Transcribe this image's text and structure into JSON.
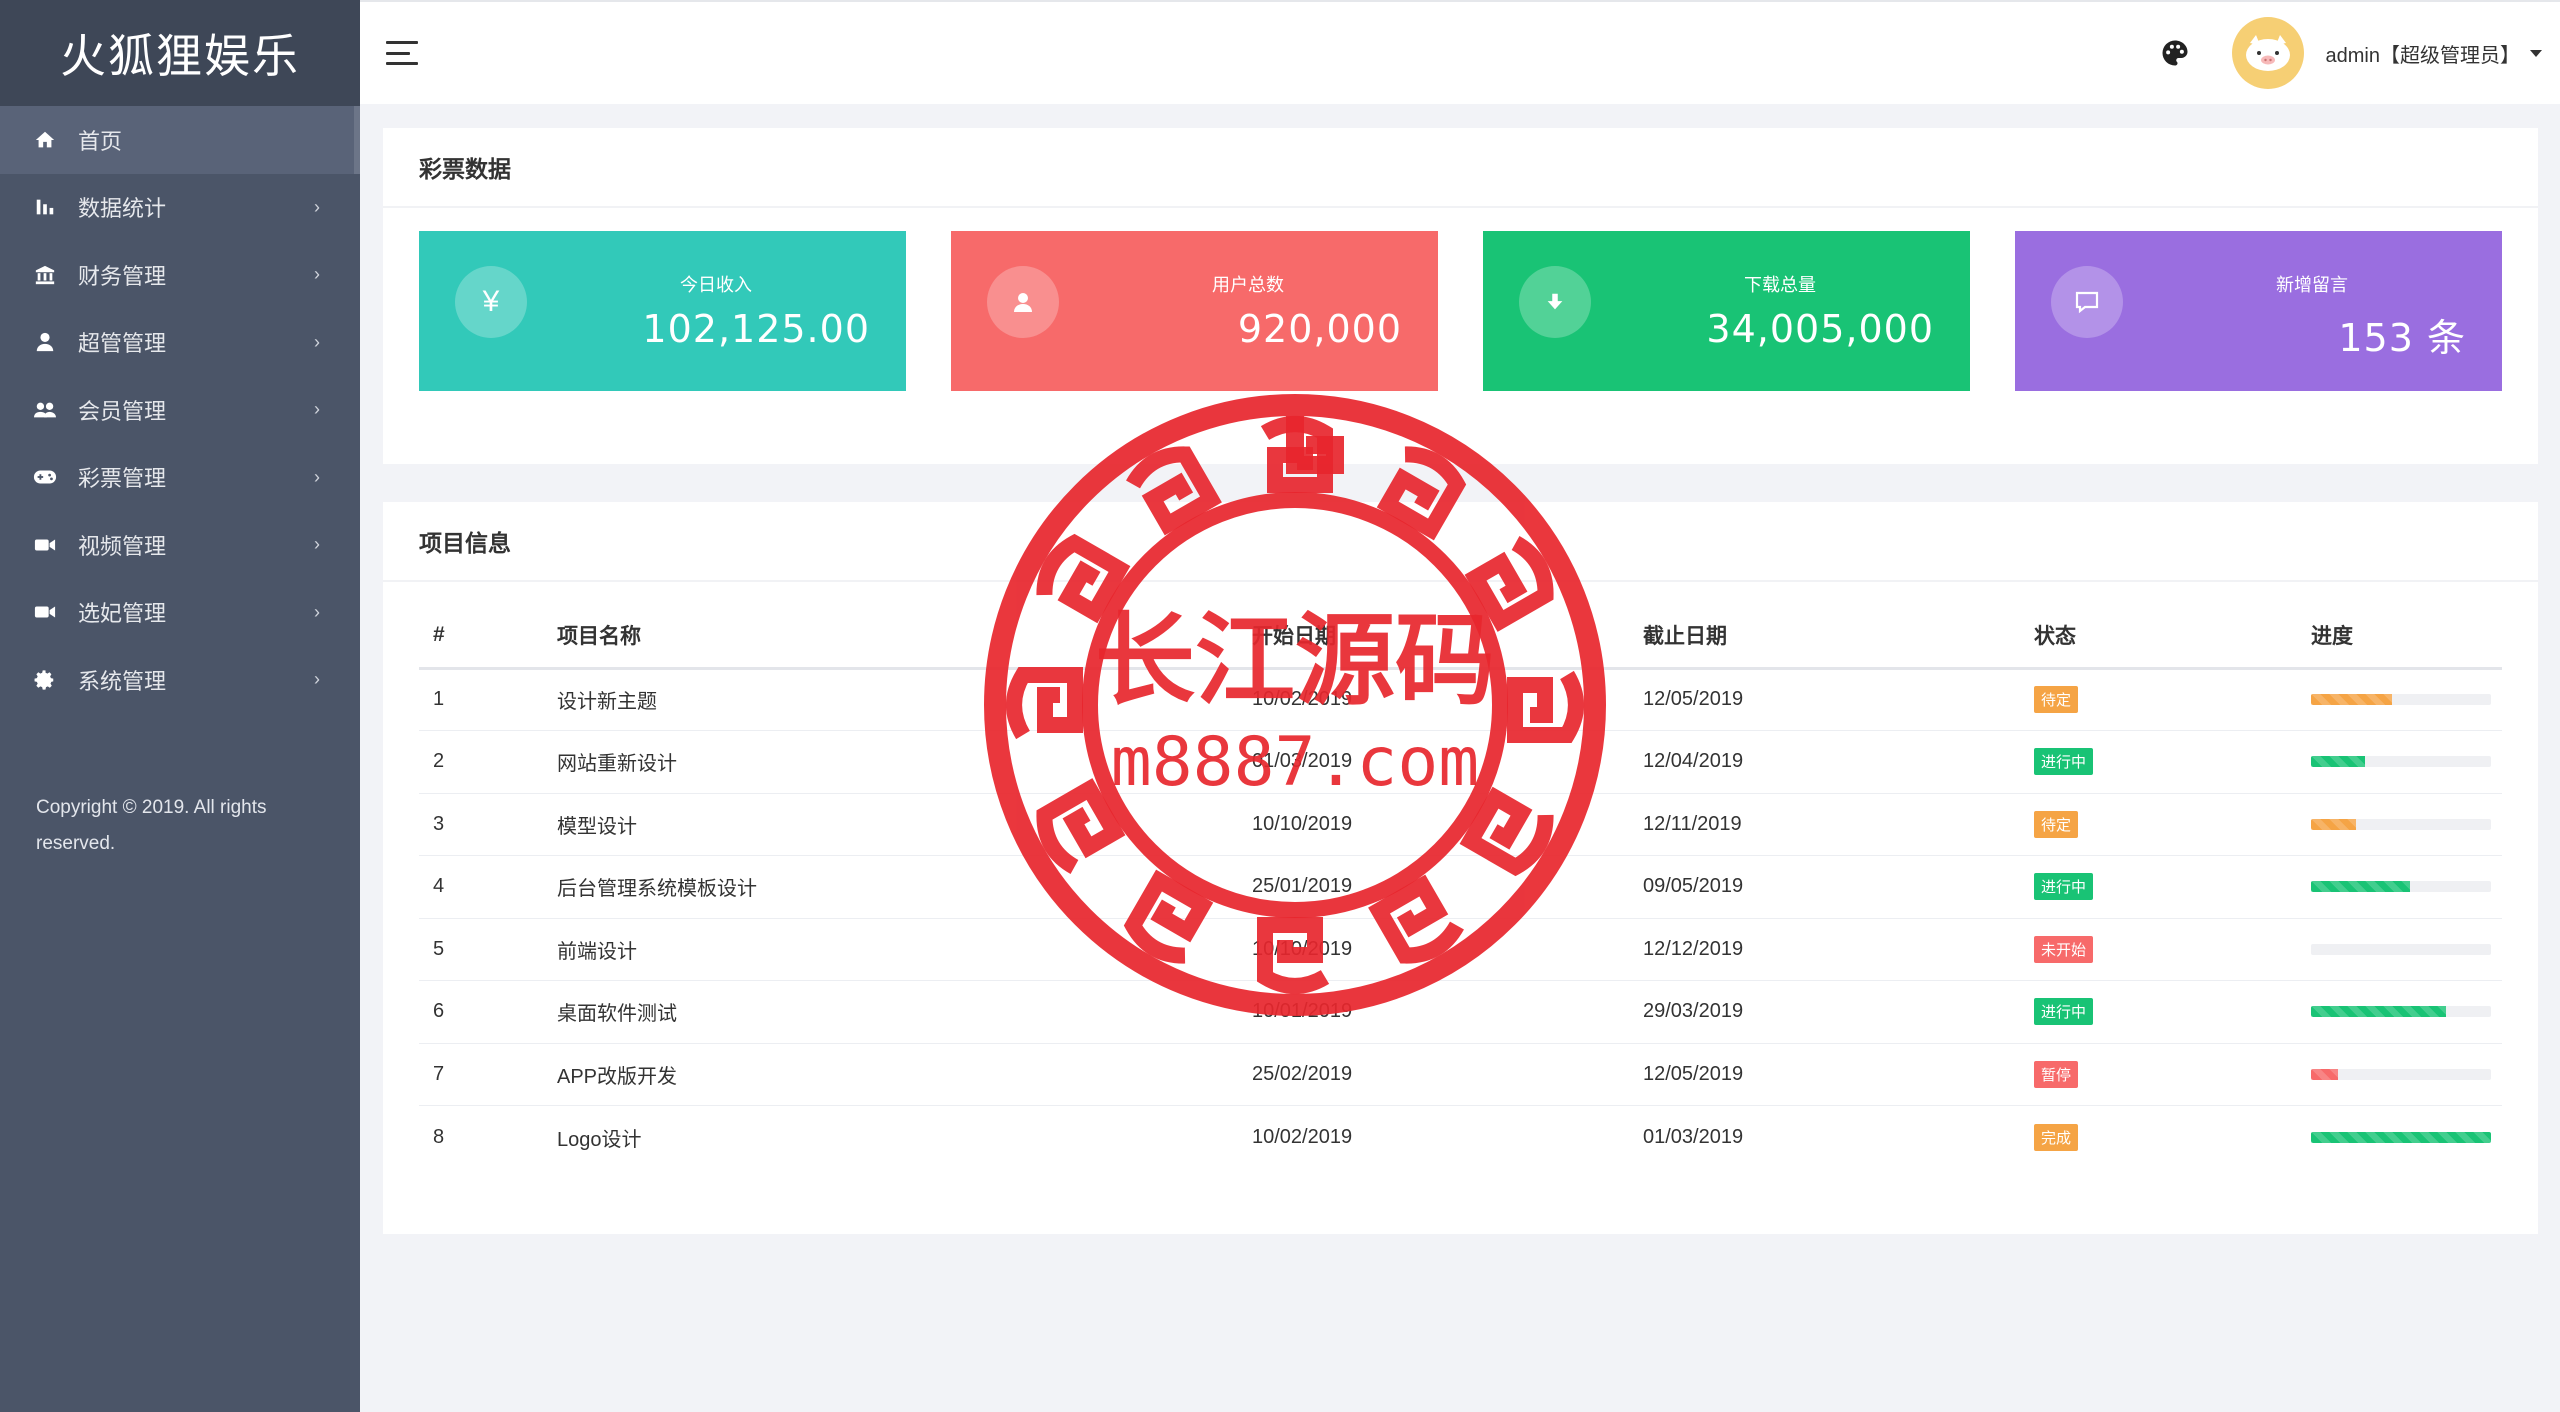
{
  "brand": "火狐狸娱乐",
  "sidebar": {
    "items": [
      {
        "label": "首页",
        "icon": "home-icon",
        "active": true
      },
      {
        "label": "数据统计",
        "icon": "bar-chart-icon"
      },
      {
        "label": "财务管理",
        "icon": "bank-icon"
      },
      {
        "label": "超管管理",
        "icon": "user-icon"
      },
      {
        "label": "会员管理",
        "icon": "users-icon"
      },
      {
        "label": "彩票管理",
        "icon": "gamepad-icon"
      },
      {
        "label": "视频管理",
        "icon": "video-camera-icon"
      },
      {
        "label": "选妃管理",
        "icon": "video-camera-icon"
      },
      {
        "label": "系统管理",
        "icon": "gear-icon"
      }
    ],
    "copyright": "Copyright © 2019. All rights reserved."
  },
  "header": {
    "user": "admin【超级管理员】",
    "icons": [
      "menu-icon",
      "palette-icon",
      "avatar",
      "caret-down-icon"
    ]
  },
  "lottery": {
    "title": "彩票数据",
    "stats": [
      {
        "label": "今日收入",
        "value": "102,125.00",
        "icon": "yen-icon",
        "color": "#32c9b9"
      },
      {
        "label": "用户总数",
        "value": "920,000",
        "icon": "user-icon",
        "color": "#f76a6a"
      },
      {
        "label": "下载总量",
        "value": "34,005,000",
        "icon": "download-icon",
        "color": "#19c375"
      },
      {
        "label": "新增留言",
        "value": "153 条",
        "icon": "comment-icon",
        "color": "#9a6ee0"
      }
    ]
  },
  "projects": {
    "title": "项目信息",
    "columns": [
      "#",
      "项目名称",
      "开始日期",
      "截止日期",
      "状态",
      "进度"
    ],
    "rows": [
      {
        "id": "1",
        "name": "设计新主题",
        "start": "10/02/2019",
        "end": "12/05/2019",
        "status": "待定",
        "status_color": "#f5a445",
        "progress": 0.45,
        "progress_color": "#f5a445"
      },
      {
        "id": "2",
        "name": "网站重新设计",
        "start": "01/03/2019",
        "end": "12/04/2019",
        "status": "进行中",
        "status_color": "#19c375",
        "progress": 0.3,
        "progress_color": "#19c375"
      },
      {
        "id": "3",
        "name": "模型设计",
        "start": "10/10/2019",
        "end": "12/11/2019",
        "status": "待定",
        "status_color": "#f5a445",
        "progress": 0.25,
        "progress_color": "#f5a445"
      },
      {
        "id": "4",
        "name": "后台管理系统模板设计",
        "start": "25/01/2019",
        "end": "09/05/2019",
        "status": "进行中",
        "status_color": "#19c375",
        "progress": 0.55,
        "progress_color": "#19c375"
      },
      {
        "id": "5",
        "name": "前端设计",
        "start": "10/10/2019",
        "end": "12/12/2019",
        "status": "未开始",
        "status_color": "#f76a6a",
        "progress": 0.0,
        "progress_color": "#19c375"
      },
      {
        "id": "6",
        "name": "桌面软件测试",
        "start": "10/01/2019",
        "end": "29/03/2019",
        "status": "进行中",
        "status_color": "#19c375",
        "progress": 0.75,
        "progress_color": "#19c375"
      },
      {
        "id": "7",
        "name": "APP改版开发",
        "start": "25/02/2019",
        "end": "12/05/2019",
        "status": "暂停",
        "status_color": "#f76a6a",
        "progress": 0.15,
        "progress_color": "#f76a6a"
      },
      {
        "id": "8",
        "name": "Logo设计",
        "start": "10/02/2019",
        "end": "01/03/2019",
        "status": "完成",
        "status_color": "#f5a445",
        "progress": 1.0,
        "progress_color": "#19c375"
      }
    ]
  },
  "watermark": {
    "line1": "长江源码",
    "line2": "m8887.com",
    "color": "#e8262d"
  }
}
